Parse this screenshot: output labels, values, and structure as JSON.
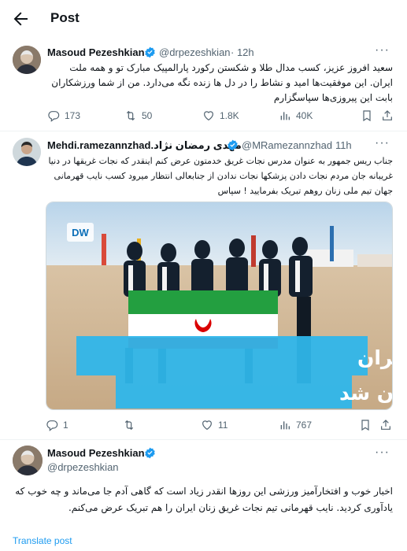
{
  "header": {
    "title": "Post"
  },
  "tweets": [
    {
      "name": "Masoud Pezeshkian",
      "handle": "@drpezeshkian",
      "time": "· 12h",
      "text": "سعید افروز عزیز، کسب مدال طلا و شکستن رکورد پارالمپیک مبارک تو و همه ملت ایران. این موفقیت‌ها امید و نشاط را در دل ها زنده نگه می‌دارد. من از شما ورزشکاران بابت این پیروزی‌ها سپاسگزارم",
      "replies": "173",
      "reposts": "50",
      "likes": "1.8K",
      "views": "40K"
    },
    {
      "name": "Mehdi.ramezannzhad.مهدی رمضان نژاد",
      "handle": "@MRamezannzhad",
      "time": "· 11h",
      "text": "جناب ریس جمهور به عنوان مدرس نجات غریق خدمتون عرض کنم اینقدر که نجات غریقها در دنیا غریبانه جان مردم نجات دادن پزشکها نجات ندادن از جنابعالی انتظار میرود کسب نایب قهرمانی جهان تیم ملی زنان روهم تبریک بفرمایید ! سپاس",
      "image_caption_line1": "تیم ملی نجات غریق زنان ایران",
      "image_caption_line2": "نایب قهرمان جهان شد",
      "image_logo": "DW",
      "replies": "1",
      "reposts": "",
      "likes": "11",
      "views": "767"
    },
    {
      "name": "Masoud Pezeshkian",
      "handle": "@drpezeshkian",
      "text": "اخبار خوب و افتخارآمیز ورزشی این روزها انقدر زیاد است که گاهی آدم جا می‌ماند و چه خوب که یادآوری کردید. نایب قهرمانی تیم نجات غریق زنان ایران را هم تبریک عرض می‌کنم.",
      "translate": "Translate post"
    }
  ],
  "icons": [
    "back-arrow-icon",
    "verified-badge-icon",
    "more-icon",
    "reply-icon",
    "repost-icon",
    "like-icon",
    "views-icon",
    "bookmark-icon",
    "share-icon"
  ],
  "colors": {
    "accent": "#1d9bf0",
    "muted": "#536471",
    "border": "#eff3f4"
  }
}
